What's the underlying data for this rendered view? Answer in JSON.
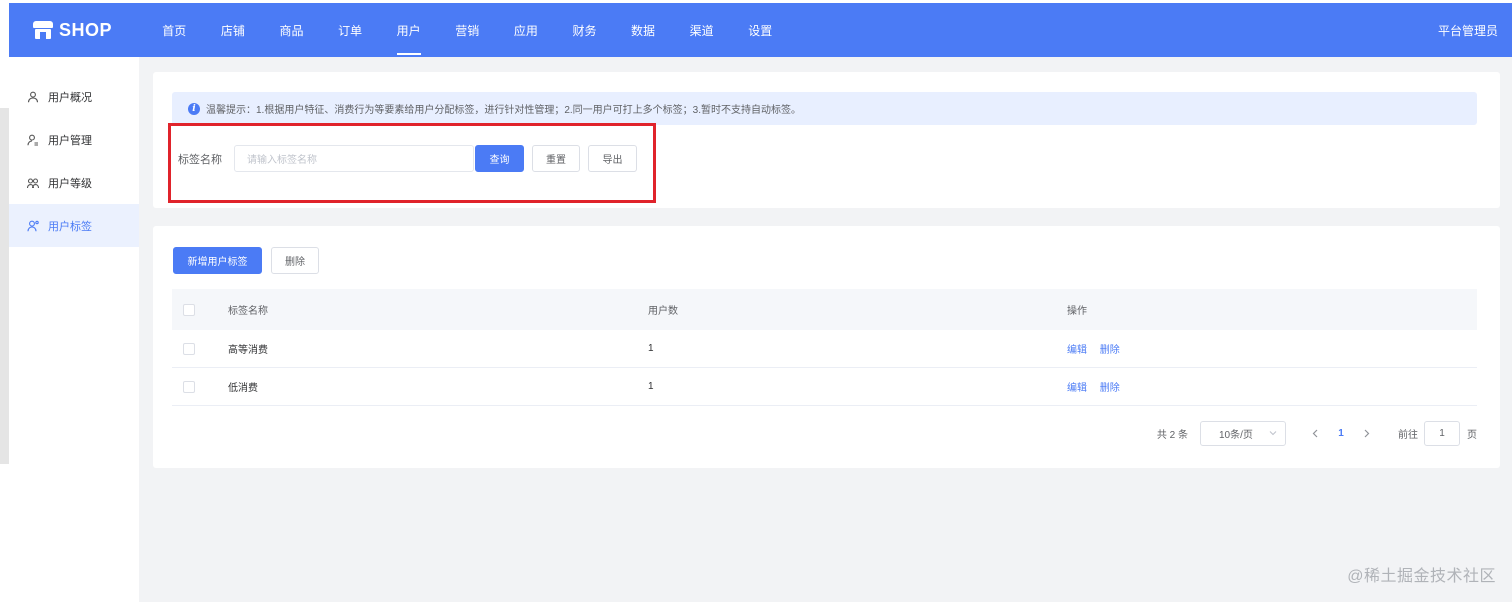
{
  "app": {
    "logo": "SHOP",
    "admin": "平台管理员"
  },
  "nav": [
    "首页",
    "店铺",
    "商品",
    "订单",
    "用户",
    "营销",
    "应用",
    "财务",
    "数据",
    "渠道",
    "设置"
  ],
  "nav_active": "用户",
  "sidebar": {
    "items": [
      {
        "label": "用户概况",
        "icon": "user-icon"
      },
      {
        "label": "用户管理",
        "icon": "user-manage-icon"
      },
      {
        "label": "用户等级",
        "icon": "users-group-icon"
      },
      {
        "label": "用户标签",
        "icon": "user-tag-icon",
        "active": true
      }
    ]
  },
  "tip": {
    "text": "温馨提示：1.根据用户特征、消费行为等要素给用户分配标签，进行针对性管理；2.同一用户可打上多个标签；3.暂时不支持自动标签。"
  },
  "search": {
    "label": "标签名称",
    "placeholder": "请输入标签名称",
    "query": "查询",
    "reset": "重置",
    "export": "导出"
  },
  "toolbar": {
    "add": "新增用户标签",
    "delete": "删除"
  },
  "table": {
    "headers": {
      "name": "标签名称",
      "count": "用户数",
      "ops": "操作"
    },
    "rows": [
      {
        "name": "高等消费",
        "count": "1"
      },
      {
        "name": "低消费",
        "count": "1"
      }
    ],
    "edit": "编辑",
    "delete": "删除"
  },
  "pager": {
    "total": "共 2 条",
    "size": "10条/页",
    "current": "1",
    "goto_label": "前往",
    "goto_value": "1",
    "goto_suffix": "页"
  },
  "watermark": "@稀土掘金技术社区",
  "colors": {
    "primary": "#4b7bf5",
    "highlight_box": "#e0232b",
    "bg": "#f2f3f5"
  }
}
